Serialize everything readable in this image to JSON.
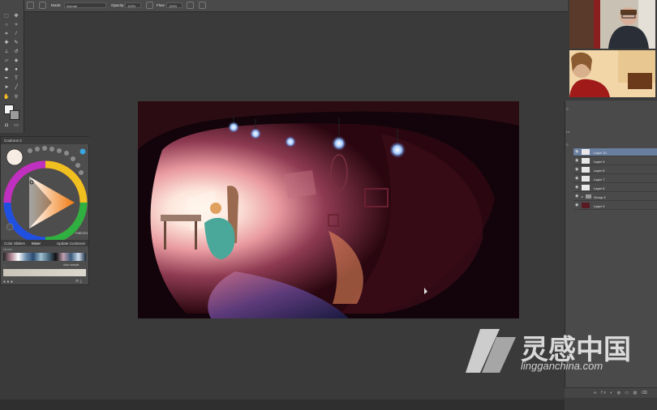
{
  "options_bar": {
    "mode_label": "Mode:",
    "mode_value": "Normal",
    "opacity_label": "Opacity:",
    "opacity_value": "100%",
    "flow_label": "Flow:",
    "flow_value": "100%"
  },
  "coolorus": {
    "title": "Coolorus 2",
    "hex": "F6ECE4",
    "tabs": [
      "Color Sliders",
      "Mixer",
      "Update Coolorus!"
    ],
    "scheme_label": "Ubuntu",
    "auto_label": "Auto sample"
  },
  "layers": {
    "side_labels": [
      "C",
      "Lo",
      "C"
    ],
    "items": [
      {
        "name": "Layer 10",
        "selected": true
      },
      {
        "name": "Layer 9",
        "selected": false
      },
      {
        "name": "Layer 8",
        "selected": false
      },
      {
        "name": "Layer 7",
        "selected": false
      },
      {
        "name": "Layer 6",
        "selected": false
      },
      {
        "name": "Group 3",
        "selected": false
      },
      {
        "name": "Layer 3",
        "selected": false
      }
    ]
  },
  "watermark": {
    "cn_text": "灵感中国",
    "url_text": "lingganchina.com"
  },
  "colors": {
    "accent_selected": "#6a7fa0",
    "panel_bg": "#4a4a4a",
    "workspace_bg": "#3a3a3a"
  }
}
